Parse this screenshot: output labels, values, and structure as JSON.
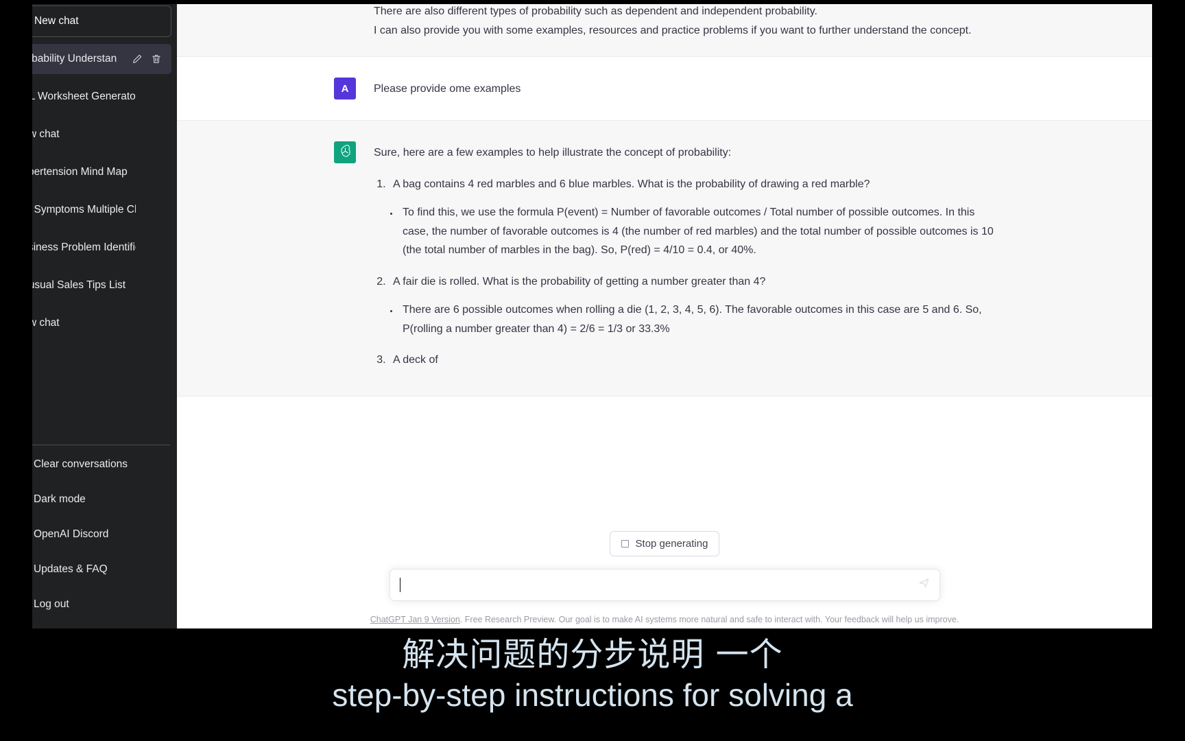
{
  "sidebar": {
    "new_chat_label": "New chat",
    "conversations": [
      {
        "title": "Probability Understan",
        "active": true
      },
      {
        "title": "ESL Worksheet Generator",
        "active": false
      },
      {
        "title": "New chat",
        "active": false
      },
      {
        "title": "Hypertension Mind Map",
        "active": false
      },
      {
        "title": "MS Symptoms Multiple Choic",
        "active": false
      },
      {
        "title": "Business Problem Identificati",
        "active": false
      },
      {
        "title": "Unusual Sales Tips List",
        "active": false
      },
      {
        "title": "New chat",
        "active": false
      }
    ],
    "footer_items": [
      {
        "label": "Clear conversations",
        "icon": "trash-icon"
      },
      {
        "label": "Dark mode",
        "icon": "moon-icon"
      },
      {
        "label": "OpenAI Discord",
        "icon": "discord-icon"
      },
      {
        "label": "Updates & FAQ",
        "icon": "external-link-icon"
      },
      {
        "label": "Log out",
        "icon": "logout-icon"
      }
    ],
    "edit_icon": "pencil-icon",
    "delete_icon": "trash-icon",
    "background_color": "#202123",
    "active_item_color": "#343541"
  },
  "thread": {
    "messages": [
      {
        "role": "assistant",
        "avatar_label": "",
        "paragraphs": [
          "There are also different types of probability such as dependent and independent probability.",
          "I can also provide you with some examples, resources and practice problems if you want to further understand the concept."
        ]
      },
      {
        "role": "user",
        "avatar_label": "A",
        "paragraphs": [
          "Please provide ome examples"
        ]
      },
      {
        "role": "assistant",
        "avatar_label": "",
        "paragraphs": [
          "Sure, here are a few examples to help illustrate the concept of probability:"
        ],
        "examples": [
          {
            "number": "1.",
            "question": "A bag contains 4 red marbles and 6 blue marbles. What is the probability of drawing a red marble?",
            "explanation": "To find this, we use the formula P(event) = Number of favorable outcomes / Total number of possible outcomes. In this case, the number of favorable outcomes is 4 (the number of red marbles) and the total number of possible outcomes is 10 (the total number of marbles in the bag). So, P(red) = 4/10 = 0.4, or 40%."
          },
          {
            "number": "2.",
            "question": "A fair die is rolled. What is the probability of getting a number greater than 4?",
            "explanation": "There are 6 possible outcomes when rolling a die (1, 2, 3, 4, 5, 6). The favorable outcomes in this case are 5 and 6. So, P(rolling a number greater than 4) = 2/6 = 1/3 or 33.3%"
          },
          {
            "number": "3.",
            "question": "A deck of",
            "explanation": ""
          }
        ]
      }
    ],
    "user_avatar_color": "#5436da",
    "assistant_avatar_color": "#10a37f"
  },
  "composer": {
    "stop_generating_label": "Stop generating",
    "stop_icon": "stop-square-icon",
    "input_value": "",
    "input_placeholder": "",
    "send_icon": "send-icon"
  },
  "footer": {
    "version_link": "ChatGPT Jan 9 Version",
    "disclaimer": ". Free Research Preview. Our goal is to make AI systems more natural and safe to interact with. Your feedback will help us improve."
  },
  "subtitles": {
    "chinese": "解决问题的分步说明 一个",
    "english": "step-by-step instructions for solving a",
    "color": "#d5e4ef"
  }
}
